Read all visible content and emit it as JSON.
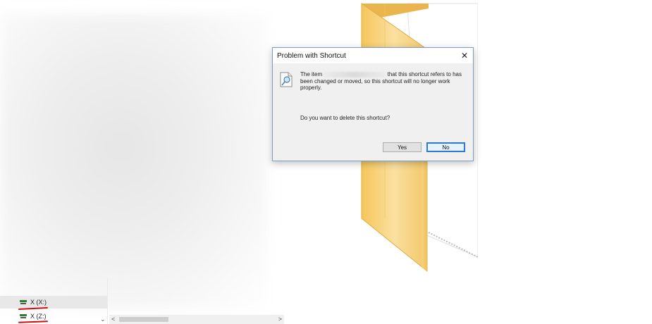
{
  "dialog": {
    "title": "Problem with Shortcut",
    "message_prefix": "The item",
    "message_suffix": "that this shortcut refers to has been changed or moved, so this shortcut will no longer work properly.",
    "question": "Do you want to delete this shortcut?",
    "yes_label": "Yes",
    "no_label": "No",
    "close_glyph": "✕"
  },
  "nav": {
    "drives": [
      {
        "label": "X (X:)",
        "icon": "network-drive-icon"
      },
      {
        "label": "X (Z:)",
        "icon": "network-drive-icon"
      }
    ],
    "chevron_glyph": "⌄"
  },
  "scrollbar": {
    "left_glyph": "<",
    "right_glyph": ">"
  },
  "colors": {
    "dialog_border": "#7a9cc7",
    "default_button_border": "#2e7bd6",
    "folder_yellow": "#f8d37a",
    "annotation_red": "#d01010"
  }
}
